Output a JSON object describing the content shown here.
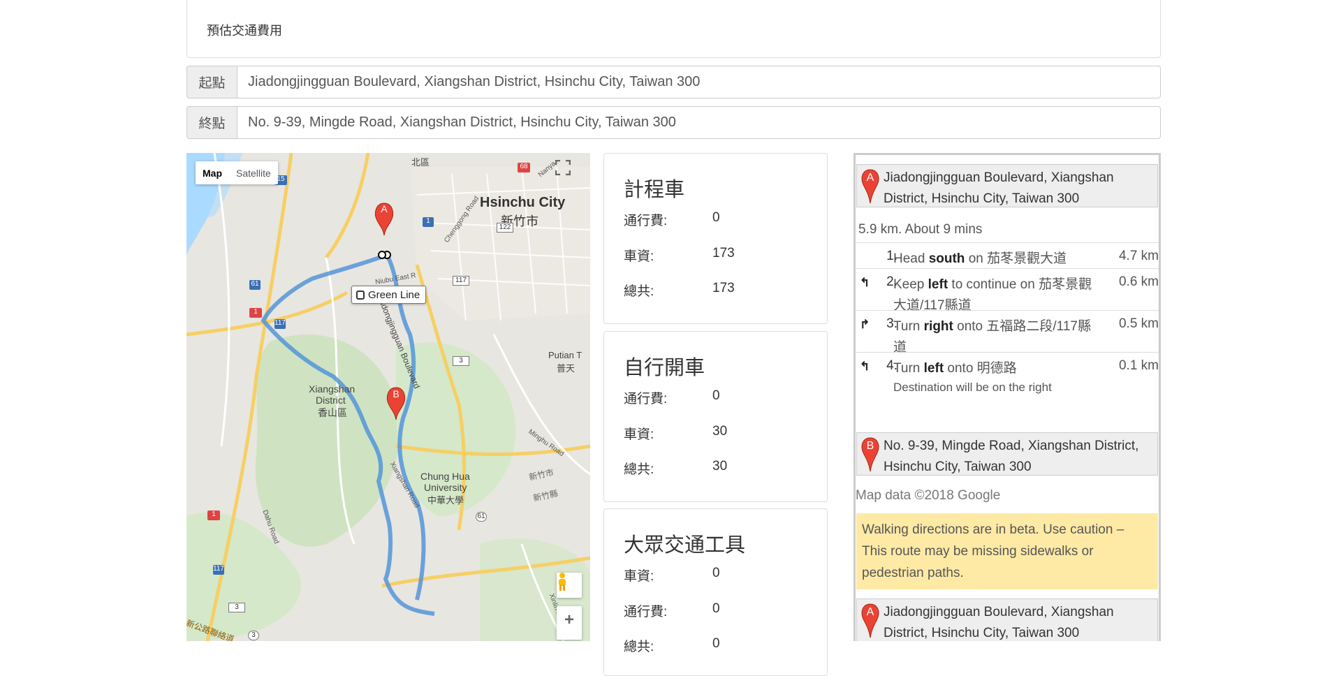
{
  "header": {
    "title": "預估交通費用"
  },
  "origin": {
    "label": "起點",
    "value": "Jiadongjingguan Boulevard, Xiangshan District, Hsinchu City, Taiwan 300"
  },
  "destination": {
    "label": "終點",
    "value": "No. 9-39, Mingde Road, Xiangshan District, Hsinchu City, Taiwan 300"
  },
  "map": {
    "map_type_map": "Map",
    "map_type_satellite": "Satellite",
    "transit_label": "Green Line",
    "labels": {
      "north_district": "北區",
      "hsinchu_city": "Hsinchu City",
      "hsinchu_city_zh": "新竹市",
      "xiangshan": "Xiangshan",
      "district": "District",
      "xiangshan_zh": "香山區",
      "chung_hua": "Chung Hua",
      "university": "University",
      "chung_hua_zh": "中華大學",
      "putian": "Putian T",
      "putian_zh": "普天",
      "jiadong_road": "Jiadongjingguan Boulevard",
      "niubu": "Niubu East R",
      "chenggong": "Chenggong Road",
      "minghu": "Minghu Road",
      "xiangshan_rd": "Xiangshan Road",
      "dahu": "Dahu Road",
      "xinlin": "Xinlin Road",
      "nanya": "Nanya",
      "hsinchu_zh2": "新竹市",
      "hsinchu_county_zh": "新竹縣",
      "bottom_zh": "新公路聯絡道"
    },
    "shields": [
      "15",
      "68",
      "1",
      "122",
      "117",
      "61",
      "1",
      "117",
      "3",
      "61",
      "1",
      "117",
      "3",
      "3"
    ],
    "marker_a": "A",
    "marker_b": "B",
    "zoom_in": "+",
    "route_color": "#4a90d9"
  },
  "taxi": {
    "title": "計程車",
    "toll_label": "通行費:",
    "toll": "0",
    "fare_label": "車資:",
    "fare": "173",
    "total_label": "總共:",
    "total": "173"
  },
  "car": {
    "title": "自行開車",
    "toll_label": "通行費:",
    "toll": "0",
    "fare_label": "車資:",
    "fare": "30",
    "total_label": "總共:",
    "total": "30"
  },
  "transit": {
    "title": "大眾交通工具",
    "fare_label": "車資:",
    "fare": "0",
    "toll_label": "通行費:",
    "toll": "0",
    "total_label": "總共:",
    "total": "0"
  },
  "directions": {
    "start_marker": "A",
    "start": "Jiadongjingguan Boulevard, Xiangshan District, Hsinchu City, Taiwan 300",
    "summary": "5.9 km. About 9 mins",
    "steps": [
      {
        "num": "1.",
        "pre": "Head ",
        "bold": "south",
        "post": " on 茄苳景觀大道",
        "dist": "4.7 km",
        "turn": ""
      },
      {
        "num": "2.",
        "pre": "Keep ",
        "bold": "left",
        "post": " to continue on 茄苳景觀大道/117縣道",
        "dist": "0.6 km",
        "turn": "↰"
      },
      {
        "num": "3.",
        "pre": "Turn ",
        "bold": "right",
        "post": " onto 五福路二段/117縣道",
        "dist": "0.5 km",
        "turn": "↱"
      },
      {
        "num": "4.",
        "pre": "Turn ",
        "bold": "left",
        "post": " onto 明德路",
        "dist": "0.1 km",
        "turn": "↰",
        "note": "Destination will be on the right"
      }
    ],
    "end_marker": "B",
    "end": "No. 9-39, Mingde Road, Xiangshan District, Hsinchu City, Taiwan 300",
    "credit": "Map data ©2018 Google",
    "warning": "Walking directions are in beta. Use caution – This route may be missing sidewalks or pedestrian paths.",
    "start2_marker": "A",
    "start2": "Jiadongjingguan Boulevard, Xiangshan District, Hsinchu City, Taiwan 300",
    "pin_color": "#ea4335"
  }
}
